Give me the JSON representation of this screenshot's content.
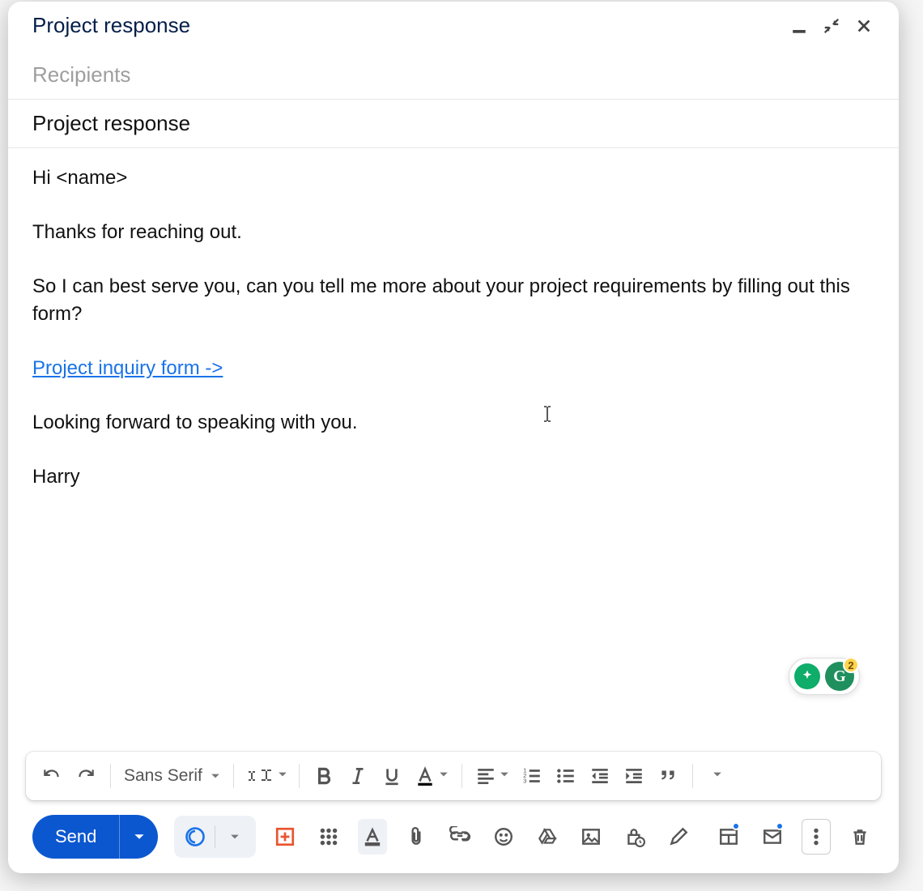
{
  "header": {
    "title": "Project response"
  },
  "recipients_placeholder": "Recipients",
  "subject": "Project response",
  "body": {
    "greeting": "Hi <name>",
    "line1": "Thanks for reaching out.",
    "line2": "So I can best serve you, can you tell me more about your project requirements by filling out this form?",
    "link_text": "Project inquiry form ->",
    "line3": "Looking forward to speaking with you.",
    "signature": "Harry"
  },
  "grammarly_badge": "2",
  "fmt": {
    "font": "Sans Serif"
  },
  "send_label": "Send"
}
